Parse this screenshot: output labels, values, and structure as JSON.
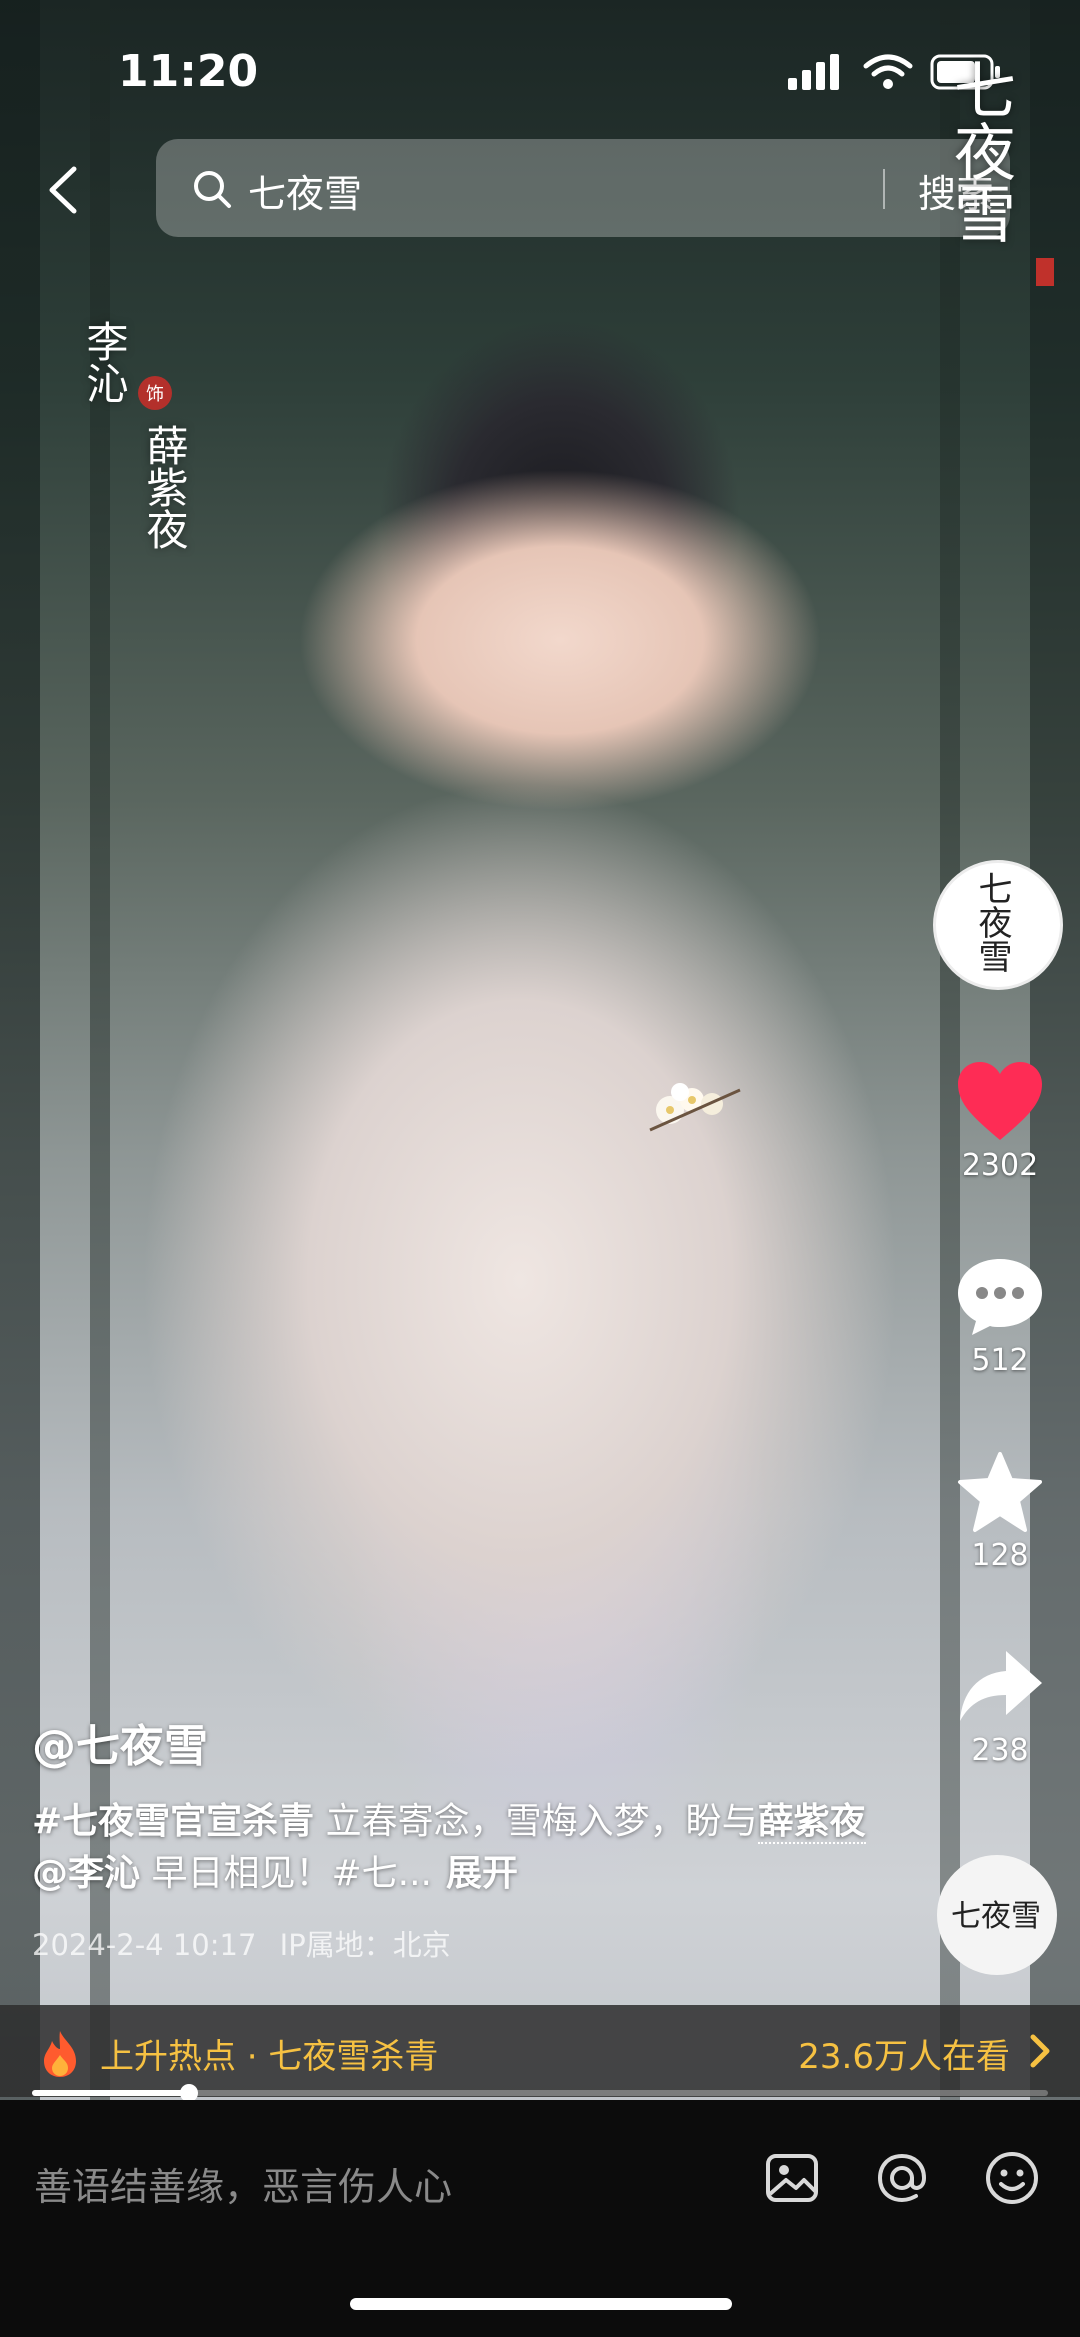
{
  "status_bar": {
    "time": "11:20"
  },
  "search": {
    "query": "七夜雪",
    "button": "搜索"
  },
  "overlay": {
    "logo": "七夜雪",
    "actor": "李沁",
    "role_seal": "饰",
    "role": "薛紫夜"
  },
  "right_bar": {
    "avatar_text": "七夜雪",
    "likes": "2302",
    "comments": "512",
    "favorites": "128",
    "shares": "238",
    "music_text": "七夜雪"
  },
  "post": {
    "author": "@七夜雪",
    "desc_tag": "#七夜雪官宣杀青",
    "desc_text": " 立春寄念，雪梅入梦，盼与",
    "desc_mention_role": "薛紫夜",
    "desc_mention": "@李沁",
    "desc_text2": " 早日相见！#七...",
    "desc_more": "展开",
    "date": "2024-2-4 10:17",
    "ip": "IP属地：北京"
  },
  "hot": {
    "label": "上升热点 · 七夜雪杀青",
    "watching": "23.6万人在看"
  },
  "progress": {
    "fraction": 0.155
  },
  "comment_input": {
    "placeholder": "善语结善缘，恶言伤人心"
  },
  "colors": {
    "like": "#fe2c55",
    "hot": "#f6c142"
  }
}
